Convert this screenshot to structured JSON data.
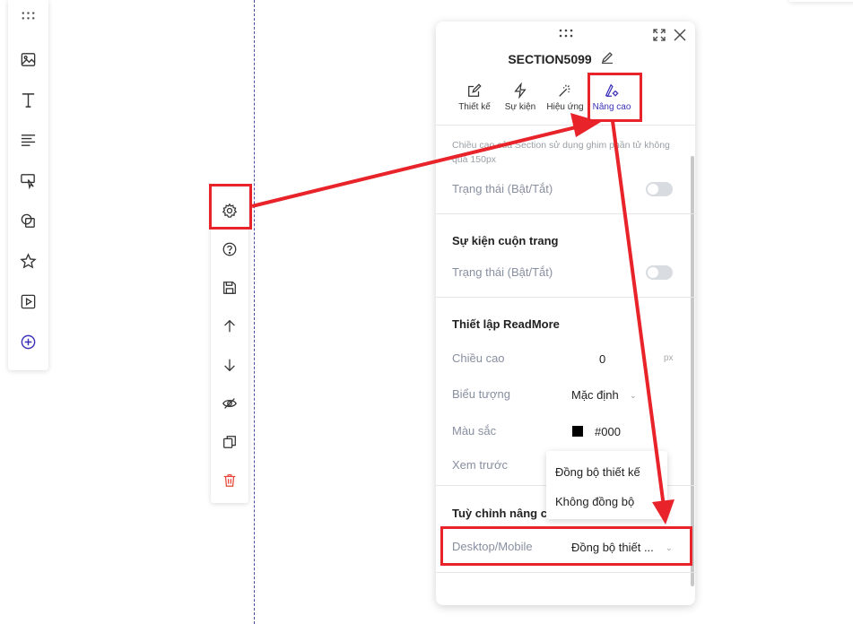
{
  "panel": {
    "title": "SECTION5099",
    "tabs": [
      {
        "label": "Thiết kế",
        "icon": "edit-icon"
      },
      {
        "label": "Sự kiện",
        "icon": "lightning-icon"
      },
      {
        "label": "Hiệu ứng",
        "icon": "magic-wand-icon"
      },
      {
        "label": "Nâng cao",
        "icon": "advanced-settings-icon"
      }
    ],
    "note": "Chiều cao của Section sử dụng ghim phần tử không quá 150px",
    "status_label_1": "Trạng thái (Bật/Tắt)",
    "scroll_event": {
      "heading": "Sự kiện cuộn trang",
      "status_label": "Trạng thái (Bật/Tắt)"
    },
    "readmore": {
      "heading": "Thiết lập ReadMore",
      "height_label": "Chiều cao",
      "height_value": "0",
      "height_unit": "px",
      "icon_label": "Biểu tượng",
      "icon_value": "Mặc định",
      "color_label": "Màu sắc",
      "color_value": "#000",
      "preview_label": "Xem trước"
    },
    "advanced": {
      "heading": "Tuỳ chỉnh nâng ca",
      "device_label": "Desktop/Mobile",
      "device_value": "Đồng bộ thiết ..."
    }
  },
  "dropdown": {
    "options": [
      "Đồng bộ thiết kế",
      "Không đồng bộ"
    ]
  },
  "colors": {
    "accent": "#3b30b8",
    "annotation": "#e8232a",
    "delete": "#e8443a"
  }
}
